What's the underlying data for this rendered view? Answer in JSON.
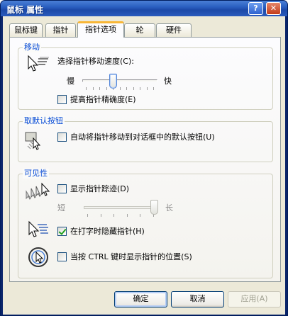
{
  "window": {
    "title": "鼠标 属性",
    "help_label": "?",
    "close_label": "✕"
  },
  "tabs": [
    {
      "label": "鼠标键",
      "active": false
    },
    {
      "label": "指针",
      "active": false
    },
    {
      "label": "指针选项",
      "active": true
    },
    {
      "label": "轮",
      "active": false
    },
    {
      "label": "硬件",
      "active": false
    }
  ],
  "motion": {
    "title": "移动",
    "speed_label": "选择指针移动速度(C):",
    "slow_label": "慢",
    "fast_label": "快",
    "speed_position": 0.4,
    "precision_label": "提高指针精确度(E)",
    "precision_checked": false
  },
  "snap_to": {
    "title": "取默认按钮",
    "label": "自动将指针移动到对话框中的默认按钮(U)",
    "checked": false
  },
  "visibility": {
    "title": "可见性",
    "trails_label": "显示指针踪迹(D)",
    "trails_checked": false,
    "short_label": "短",
    "long_label": "长",
    "trails_position": 1.0,
    "hide_typing_label": "在打字时隐藏指针(H)",
    "hide_typing_checked": true,
    "show_location_label": "当按 CTRL 键时显示指针的位置(S)",
    "show_location_checked": false
  },
  "buttons": {
    "ok": "确定",
    "cancel": "取消",
    "apply": "应用(A)"
  },
  "colors": {
    "group_title": "#0046d5",
    "titlebar": "#2a5fc0",
    "dialog": "#ece9d8"
  }
}
